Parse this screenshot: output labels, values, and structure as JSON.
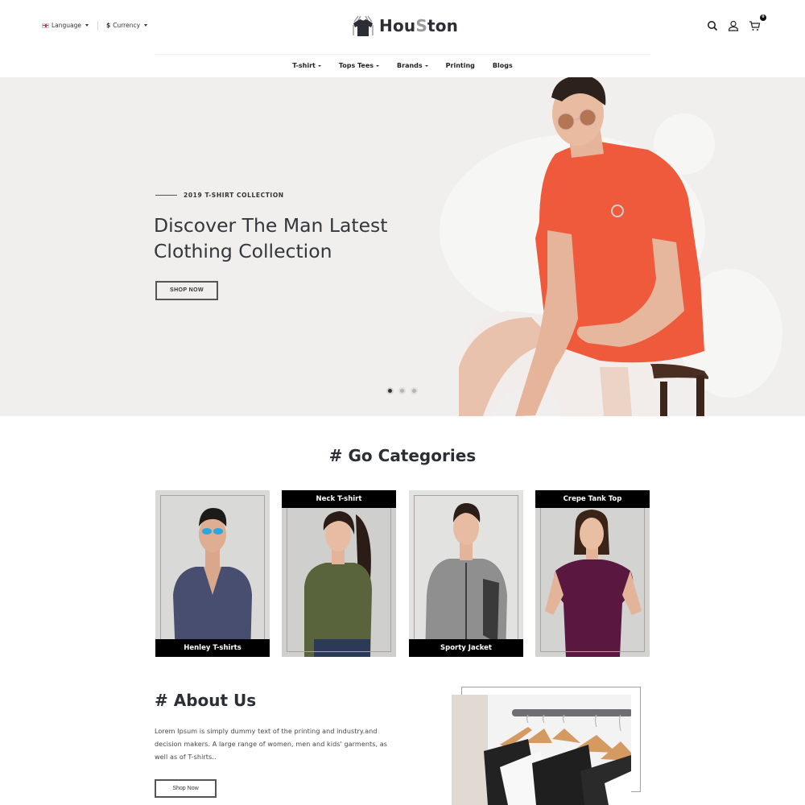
{
  "topbar": {
    "language_label": "Language",
    "currency_symbol": "$",
    "currency_label": "Currency"
  },
  "logo": {
    "text_before": "Hou",
    "text_accent": "S",
    "text_after": "ton"
  },
  "header_icons": {
    "search": "search-icon",
    "account": "user-icon",
    "cart": "cart-icon",
    "cart_count": "0"
  },
  "nav": {
    "items": [
      {
        "label": "T-shirt",
        "dropdown": true
      },
      {
        "label": "Tops Tees",
        "dropdown": true
      },
      {
        "label": "Brands",
        "dropdown": true
      },
      {
        "label": "Printing",
        "dropdown": false
      },
      {
        "label": "Blogs",
        "dropdown": false
      }
    ]
  },
  "hero": {
    "kicker": "2019 T-SHIRT COLLECTION",
    "title_line1": "Discover The Man Latest",
    "title_line2": "Clothing Collection",
    "button": "SHOP NOW",
    "slides_total": 3,
    "active_slide": 1
  },
  "categories": {
    "title": "# Go Categories",
    "items": [
      {
        "label": "Henley T-shirts",
        "label_position": "bottom",
        "shirt_color": "#474e6f"
      },
      {
        "label": "Neck T-shirt",
        "label_position": "top",
        "shirt_color": "#59643c"
      },
      {
        "label": "Sporty Jacket",
        "label_position": "bottom",
        "shirt_color": "#8f8f8f"
      },
      {
        "label": "Crepe Tank Top",
        "label_position": "top",
        "shirt_color": "#5a1840"
      }
    ]
  },
  "about": {
    "title": "# About Us",
    "text": "Lorem Ipsum is simply dummy text of the printing and industry.and decision makers. A large range of women, men and kids' garments, as well as of T-shirts..",
    "button": "Shop Now"
  },
  "colors": {
    "hero_bg": "#f0efed",
    "text_dark": "#2b2e34",
    "accent_gray": "#9a9a9a",
    "label_bg": "#000000",
    "hero_shirt": "#f05a3c"
  }
}
